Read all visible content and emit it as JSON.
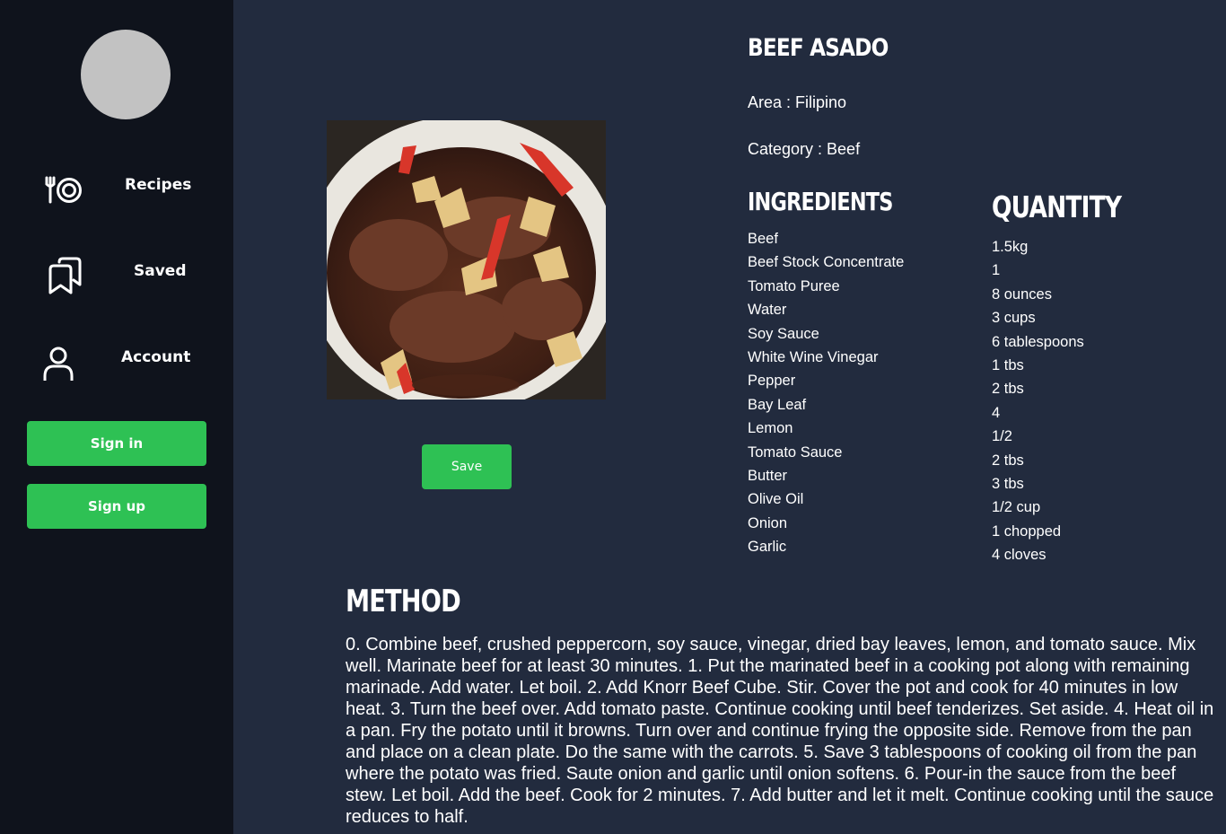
{
  "sidebar": {
    "items": [
      {
        "label": "Recipes",
        "icon": "plate-fork-icon"
      },
      {
        "label": "Saved",
        "icon": "bookmarks-icon"
      },
      {
        "label": "Account",
        "icon": "user-icon"
      }
    ],
    "sign_in": "Sign in",
    "sign_up": "Sign up",
    "button_color": "#2ec154"
  },
  "recipe": {
    "title": "BEEF ASADO",
    "area": "Area : Filipino",
    "category": "Category : Beef",
    "save_label": "Save",
    "ingredients_heading": "INGREDIENTS",
    "quantity_heading": "QUANTITY",
    "ingredients": [
      "Beef",
      "Beef Stock Concentrate",
      "Tomato Puree",
      "Water",
      "Soy Sauce",
      "White Wine Vinegar",
      "Pepper",
      "Bay Leaf",
      "Lemon",
      "Tomato Sauce",
      "Butter",
      "Olive Oil",
      "Onion",
      "Garlic"
    ],
    "quantities": [
      "1.5kg",
      "1",
      "8 ounces",
      "3 cups",
      "6 tablespoons",
      "1 tbs",
      "2 tbs",
      "4",
      "1/2",
      "2 tbs",
      "3 tbs",
      "1/2 cup",
      "1 chopped",
      "4 cloves"
    ],
    "method_heading": "METHOD",
    "method": "0. Combine beef, crushed peppercorn, soy sauce, vinegar, dried bay leaves, lemon, and tomato sauce. Mix well. Marinate beef for at least 30 minutes. 1. Put the marinated beef in a cooking pot along with remaining marinade. Add water. Let boil. 2. Add Knorr Beef Cube. Stir. Cover the pot and cook for 40 minutes in low heat. 3. Turn the beef over. Add tomato paste. Continue cooking until beef tenderizes. Set aside. 4. Heat oil in a pan. Fry the potato until it browns. Turn over and continue frying the opposite side. Remove from the pan and place on a clean plate. Do the same with the carrots. 5. Save 3 tablespoons of cooking oil from the pan where the potato was fried. Saute onion and garlic until onion softens. 6. Pour-in the sauce from the beef stew. Let boil. Add the beef. Cook for 2 minutes. 7. Add butter and let it melt. Continue cooking until the sauce reduces to half."
  }
}
